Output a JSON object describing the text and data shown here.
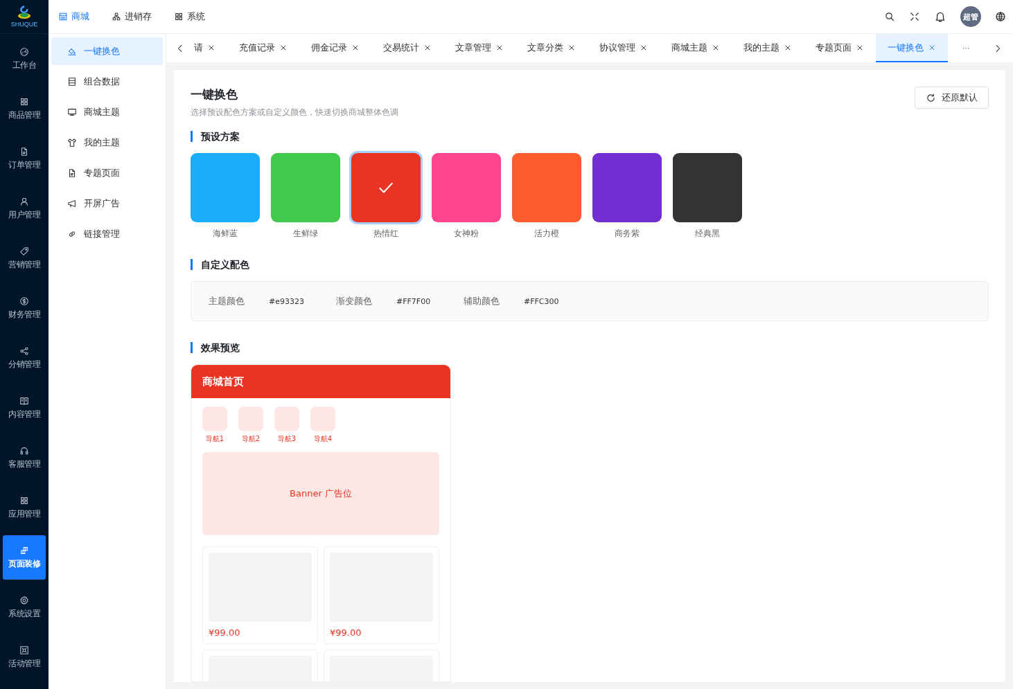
{
  "logo": {
    "text": "SHUQUE"
  },
  "main_nav": [
    {
      "label": "工作台",
      "selected": false
    },
    {
      "label": "商品管理",
      "selected": false
    },
    {
      "label": "订单管理",
      "selected": false
    },
    {
      "label": "用户管理",
      "selected": false
    },
    {
      "label": "营销管理",
      "selected": false
    },
    {
      "label": "财务管理",
      "selected": false
    },
    {
      "label": "分销管理",
      "selected": false
    },
    {
      "label": "内容管理",
      "selected": false
    },
    {
      "label": "客服管理",
      "selected": false
    },
    {
      "label": "应用管理",
      "selected": false
    },
    {
      "label": "页面装修",
      "selected": true
    },
    {
      "label": "系统设置",
      "selected": false
    },
    {
      "label": "活动管理",
      "selected": false
    }
  ],
  "top_menu": [
    {
      "label": "商城",
      "selected": true
    },
    {
      "label": "进销存",
      "selected": false
    },
    {
      "label": "系统",
      "selected": false
    }
  ],
  "user": {
    "avatar": "超管"
  },
  "sub_nav": [
    {
      "label": "一键换色",
      "selected": true
    },
    {
      "label": "组合数据",
      "selected": false
    },
    {
      "label": "商城主题",
      "selected": false
    },
    {
      "label": "我的主题",
      "selected": false
    },
    {
      "label": "专题页面",
      "selected": false
    },
    {
      "label": "开屏广告",
      "selected": false
    },
    {
      "label": "链接管理",
      "selected": false
    }
  ],
  "tabs": [
    {
      "label": "请",
      "selected": false
    },
    {
      "label": "充值记录",
      "selected": false
    },
    {
      "label": "佣金记录",
      "selected": false
    },
    {
      "label": "交易统计",
      "selected": false
    },
    {
      "label": "文章管理",
      "selected": false
    },
    {
      "label": "文章分类",
      "selected": false
    },
    {
      "label": "协议管理",
      "selected": false
    },
    {
      "label": "商城主题",
      "selected": false
    },
    {
      "label": "我的主题",
      "selected": false
    },
    {
      "label": "专题页面",
      "selected": false
    },
    {
      "label": "一键换色",
      "selected": true
    }
  ],
  "tabs_more": "···",
  "page": {
    "title": "一键换色",
    "subtitle": "选择预设配色方案或自定义颜色，快速切换商城整体色调",
    "reset_button": "还原默认"
  },
  "presets": {
    "title": "预设方案",
    "items": [
      {
        "name": "海鲜蓝",
        "color": "#1aadf9",
        "selected": false
      },
      {
        "name": "生鲜绿",
        "color": "#42c84c",
        "selected": false
      },
      {
        "name": "热情红",
        "color": "#e93323",
        "selected": true
      },
      {
        "name": "女神粉",
        "color": "#ff448f",
        "selected": false
      },
      {
        "name": "活力橙",
        "color": "#fe5c2d",
        "selected": false
      },
      {
        "name": "商务紫",
        "color": "#722ed1",
        "selected": false
      },
      {
        "name": "经典黑",
        "color": "#333333",
        "selected": false
      }
    ]
  },
  "custom": {
    "title": "自定义配色",
    "items": [
      {
        "label": "主题颜色",
        "value": "#e93323"
      },
      {
        "label": "渐变颜色",
        "value": "#FF7F00"
      },
      {
        "label": "辅助颜色",
        "value": "#FFC300"
      }
    ]
  },
  "preview": {
    "title": "效果预览",
    "header": "商城首页",
    "nav": [
      "导航1",
      "导航2",
      "导航3",
      "导航4"
    ],
    "banner": "Banner 广告位",
    "products": [
      {
        "kind": "picture",
        "price": "¥99.00"
      },
      {
        "kind": "picture",
        "price": "¥99.00"
      },
      {
        "kind": "picture"
      },
      {
        "kind": "picture"
      }
    ]
  }
}
